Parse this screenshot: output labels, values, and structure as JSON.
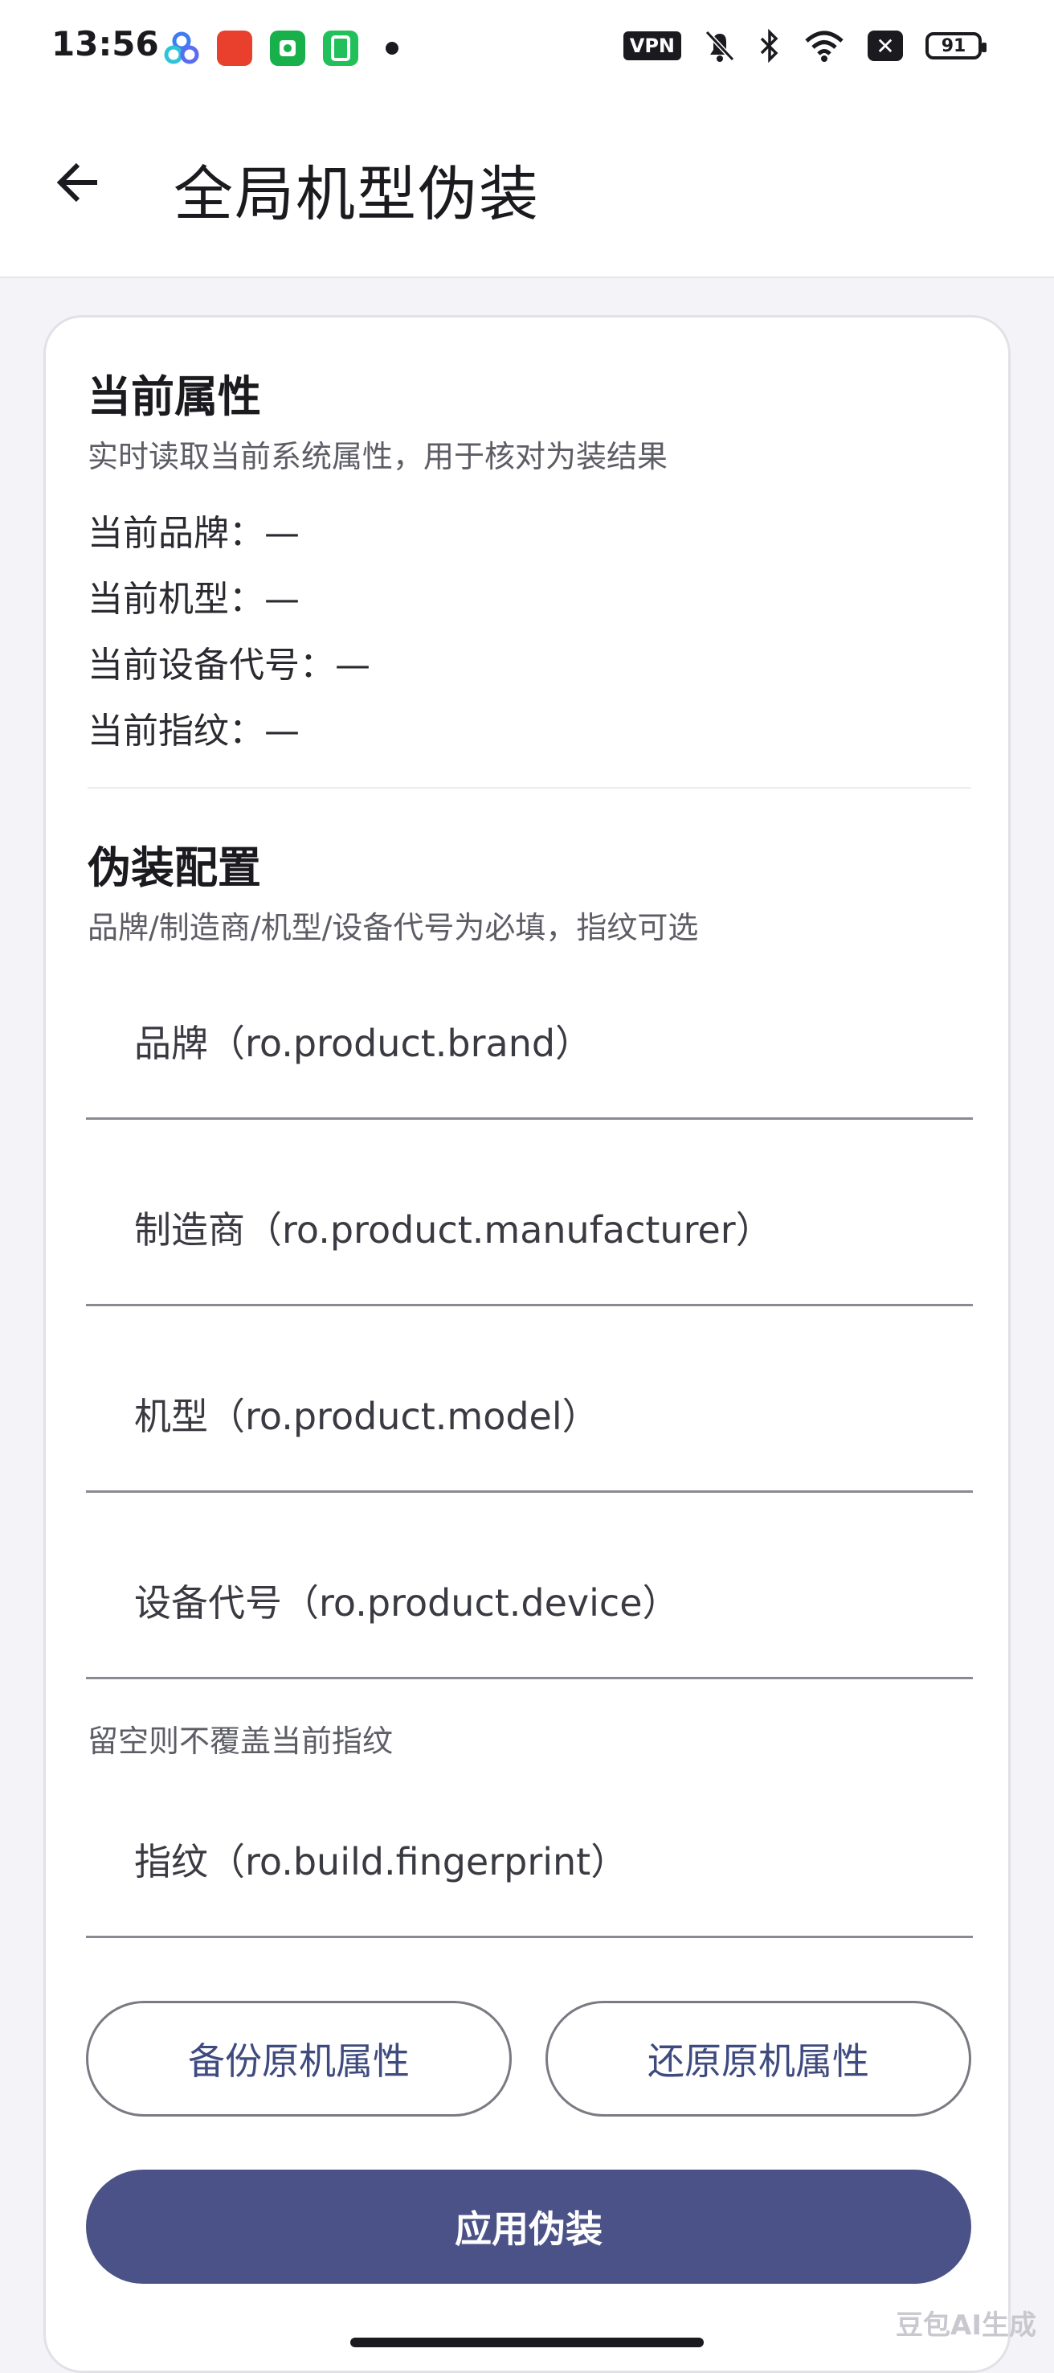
{
  "status_bar": {
    "time": "13:56",
    "vpn_label": "VPN",
    "x_label": "✕",
    "battery": "91"
  },
  "app_bar": {
    "title": "全局机型伪装"
  },
  "current_props": {
    "title": "当前属性",
    "subtitle": "实时读取当前系统属性，用于核对为装结果",
    "items": [
      "当前品牌：—",
      "当前机型：—",
      "当前设备代号：—",
      "当前指纹：—"
    ]
  },
  "spoof_config": {
    "title": "伪装配置",
    "subtitle": "品牌/制造商/机型/设备代号为必填，指纹可选",
    "fields": {
      "brand": "品牌（ro.product.brand）",
      "manufacturer": "制造商（ro.product.manufacturer）",
      "model": "机型（ro.product.model）",
      "device": "设备代号（ro.product.device）",
      "fingerprint": "指纹（ro.build.fingerprint）"
    },
    "fingerprint_hint": "留空则不覆盖当前指纹"
  },
  "actions": {
    "backup": "备份原机属性",
    "restore": "还原原机属性",
    "apply": "应用伪装"
  },
  "watermark": "豆包AI生成",
  "colors": {
    "primary": "#4b5287",
    "outline_text": "#3f4a7f",
    "background": "#f4f3f8"
  }
}
